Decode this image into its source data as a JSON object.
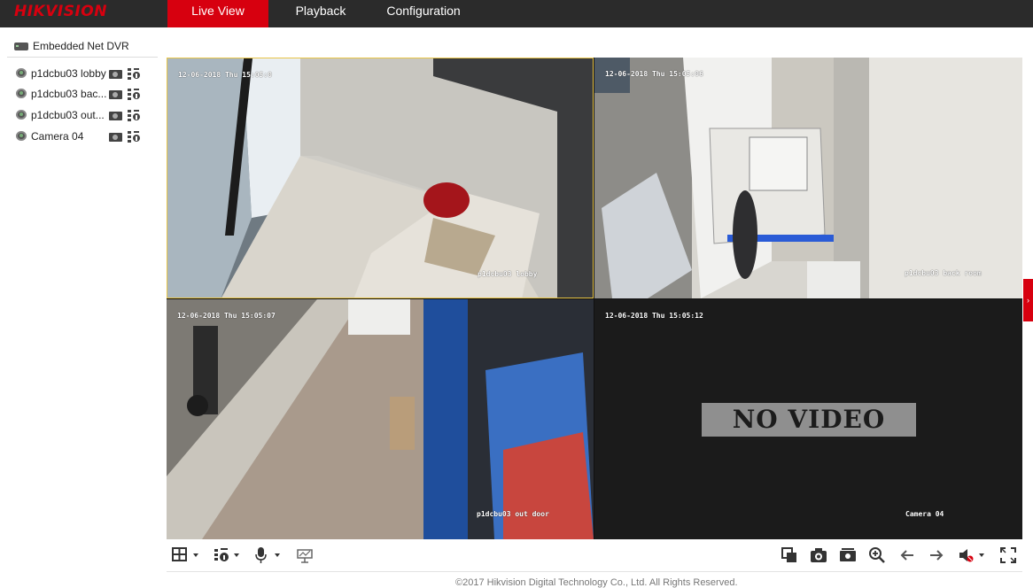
{
  "brand": {
    "logo_text": "HIKVISION",
    "accent_color": "#d7000f"
  },
  "nav": {
    "tabs": [
      {
        "label": "Live View",
        "active": true
      },
      {
        "label": "Playback",
        "active": false
      },
      {
        "label": "Configuration",
        "active": false
      }
    ]
  },
  "sidebar": {
    "device_label": "Embedded Net DVR",
    "cameras": [
      {
        "label": "p1dcbu03 lobby"
      },
      {
        "label": "p1dcbu03 bac..."
      },
      {
        "label": "p1dcbu03 out..."
      },
      {
        "label": "Camera 04"
      }
    ]
  },
  "viewer": {
    "layout": "2x2",
    "tiles": [
      {
        "timestamp": "12-06-2018 Thu 15:05:0",
        "channel_name": "p1dcbu03 lobby",
        "selected": true,
        "has_video": true
      },
      {
        "timestamp": "12-06-2018 Thu 15:05:06",
        "channel_name": "p1dcbu03 back room",
        "selected": false,
        "has_video": true
      },
      {
        "timestamp": "12-06-2018 Thu 15:05:07",
        "channel_name": "p1dcbu03 out door",
        "selected": false,
        "has_video": true
      },
      {
        "timestamp": "12-06-2018 Thu 15:05:12",
        "channel_name": "Camera 04",
        "selected": false,
        "has_video": false,
        "status_text": "NO VIDEO"
      }
    ]
  },
  "toolbar": {
    "left_icons": [
      "window-layout-icon",
      "ptz-icon",
      "microphone-icon",
      "map-icon"
    ],
    "right_icons": [
      "stop-all-icon",
      "capture-icon",
      "record-icon",
      "digital-zoom-icon",
      "previous-page-icon",
      "next-page-icon",
      "audio-muted-icon",
      "fullscreen-icon"
    ]
  },
  "footer": {
    "copyright": "©2017 Hikvision Digital Technology Co., Ltd. All Rights Reserved."
  }
}
